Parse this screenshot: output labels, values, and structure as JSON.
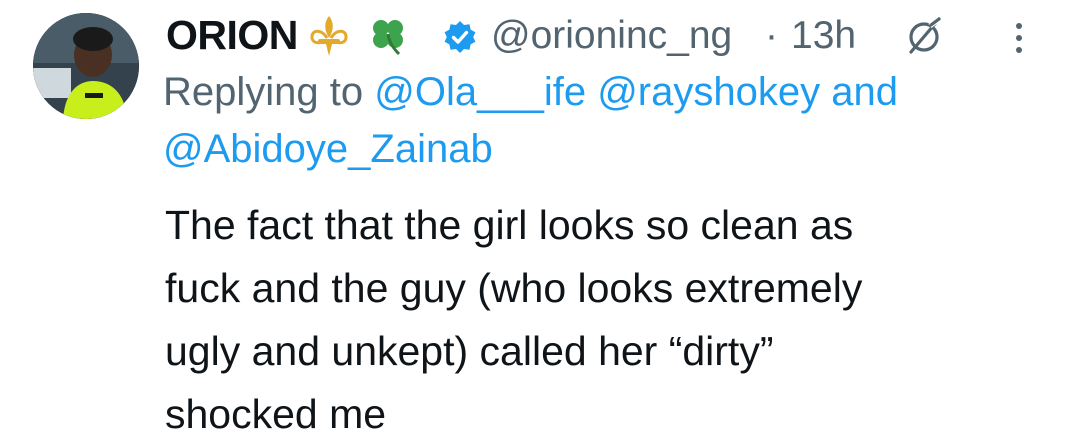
{
  "tweet": {
    "author": {
      "display_name": "ORION",
      "emojis": [
        "fleur-de-lis-icon",
        "four-leaf-clover-icon"
      ],
      "verified": true,
      "handle": "@orioninc_ng"
    },
    "separator": "·",
    "time": "13h",
    "reply": {
      "prefix": "Replying to ",
      "mentions": [
        "@Ola___ife",
        "@rayshokey",
        "@Abidoye_Zainab"
      ],
      "conjunction": "and"
    },
    "text": "The fact that the girl looks so clean as\nfuck and the guy (who looks extremely\nugly and unkept) called her “dirty”\nshocked me"
  },
  "colors": {
    "text": "#0f1419",
    "secondary": "#536471",
    "link": "#1d9bf0",
    "verified": "#1d9bf0"
  }
}
